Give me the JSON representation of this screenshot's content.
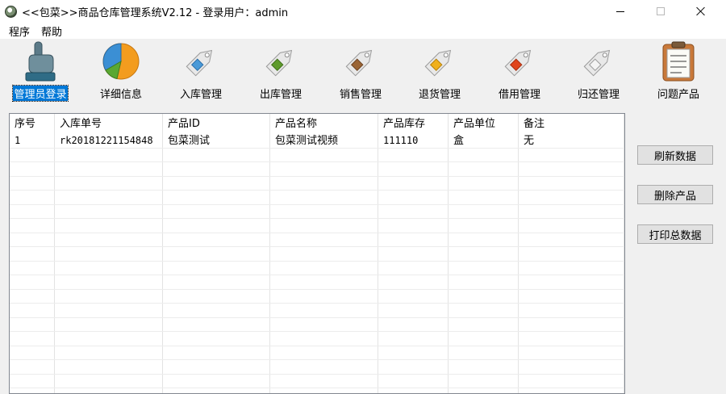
{
  "window": {
    "title": "<<包菜>>商品仓库管理系统V2.12  - 登录用户：admin"
  },
  "menu": {
    "items": [
      "程序",
      "帮助"
    ]
  },
  "toolbar": {
    "items": [
      {
        "label": "管理员登录",
        "icon": "admin-hand-icon",
        "selected": true
      },
      {
        "label": "详细信息",
        "icon": "pie-chart-icon",
        "selected": false
      },
      {
        "label": "入库管理",
        "icon": "tag-blue-icon",
        "selected": false
      },
      {
        "label": "出库管理",
        "icon": "tag-green-icon",
        "selected": false
      },
      {
        "label": "销售管理",
        "icon": "tag-brown-icon",
        "selected": false
      },
      {
        "label": "退货管理",
        "icon": "tag-yellow-icon",
        "selected": false
      },
      {
        "label": "借用管理",
        "icon": "tag-red-icon",
        "selected": false
      },
      {
        "label": "归还管理",
        "icon": "tag-white-icon",
        "selected": false
      },
      {
        "label": "问题产品",
        "icon": "clipboard-icon",
        "selected": false
      }
    ],
    "colors": {
      "tag_blue": "#4a9ad8",
      "tag_green": "#5e9b2c",
      "tag_brown": "#9a6434",
      "tag_yellow": "#f0b01c",
      "tag_red": "#e0451c",
      "tag_white": "#f4f4f4",
      "selection": "#0078d7"
    }
  },
  "table": {
    "columns": [
      "序号",
      "入库单号",
      "产品ID",
      "产品名称",
      "产品库存",
      "产品单位",
      "备注"
    ],
    "rows": [
      [
        "1",
        "rk20181221154848",
        "包菜测试",
        "包菜测试视频",
        "111110",
        "盒",
        "无"
      ]
    ]
  },
  "buttons": {
    "refresh": "刷新数据",
    "delete": "删除产品",
    "print": "打印总数据"
  }
}
